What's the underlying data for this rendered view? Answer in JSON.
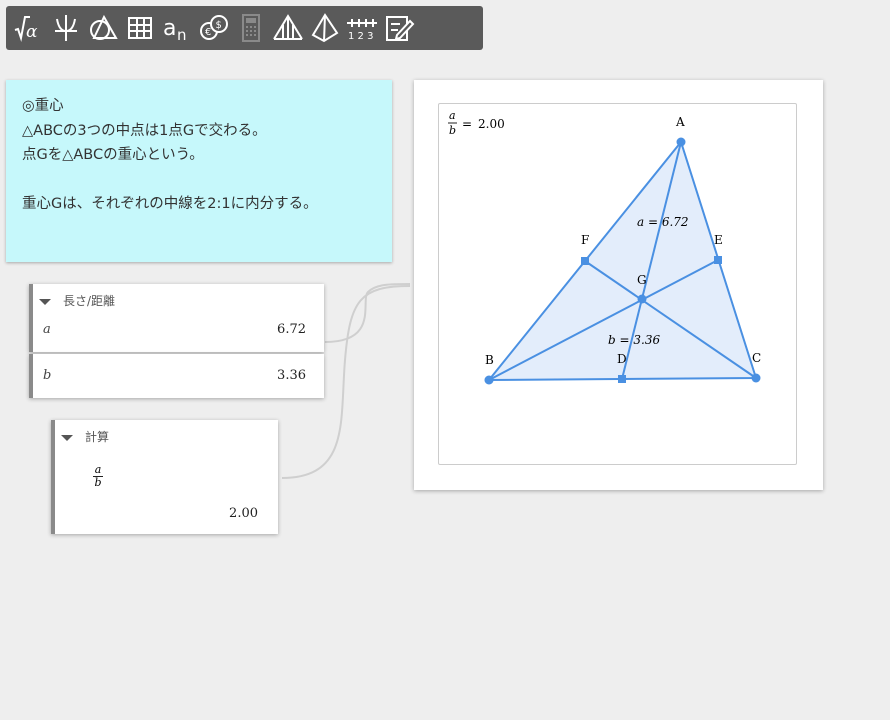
{
  "toolbar": {
    "tools": [
      {
        "name": "math-tool"
      },
      {
        "name": "function-tool"
      },
      {
        "name": "geometry-tool"
      },
      {
        "name": "table-tool"
      },
      {
        "name": "sequence-tool"
      },
      {
        "name": "currency-tool"
      },
      {
        "name": "calculator-tool"
      },
      {
        "name": "statistics-tool"
      },
      {
        "name": "3d-tool"
      },
      {
        "name": "number-line-tool"
      },
      {
        "name": "note-tool"
      }
    ]
  },
  "note": {
    "line1": "◎重心",
    "line2": "△ABCの3つの中点は1点Gで交わる。",
    "line3": "点Gを△ABCの重心という。",
    "line4": "重心Gは、それぞれの中線を2:1に内分する。"
  },
  "length_panel": {
    "title": "長さ/距離",
    "rows": [
      {
        "name": "a",
        "value": "6.72"
      },
      {
        "name": "b",
        "value": "3.36"
      }
    ]
  },
  "calc_panel": {
    "title": "計算",
    "numerator": "a",
    "denominator": "b",
    "value": "2.00"
  },
  "graph": {
    "ratio_numerator": "a",
    "ratio_denominator": "b",
    "ratio_eq": "=",
    "ratio_value": "2.00",
    "points": {
      "A": "A",
      "B": "B",
      "C": "C",
      "D": "D",
      "E": "E",
      "F": "F",
      "G": "G"
    },
    "label_a": "a = 6.72",
    "label_b": "b = 3.36",
    "stroke_color": "#4a90e2",
    "fill_color": "#e3edfb"
  }
}
